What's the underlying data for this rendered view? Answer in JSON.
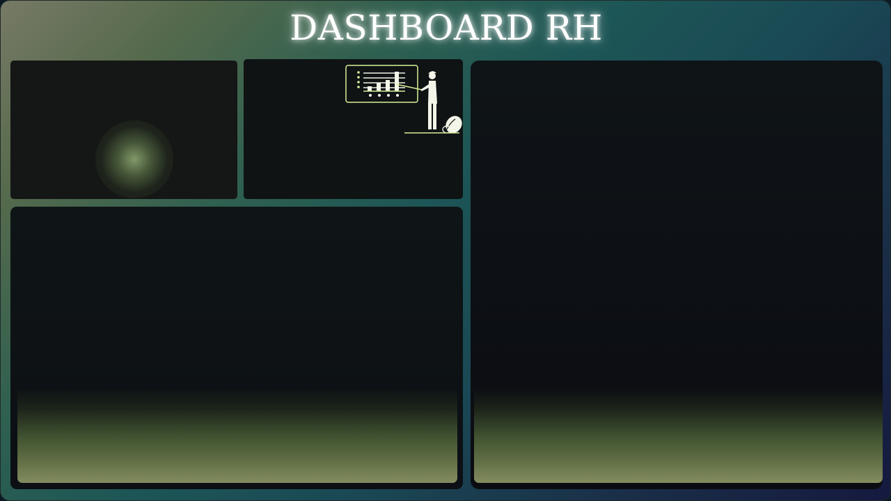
{
  "header": {
    "title": "DASHBOARD RH"
  },
  "theme": {
    "accent": "#d8f29a",
    "panel_bg": "#0f1314",
    "background_gradient": [
      "#777a66",
      "#1d5656",
      "#15193f"
    ]
  },
  "panels": {
    "kpi_left": {
      "icon": "glow-orb"
    },
    "kpi_right": {
      "icon": "presenter-chart-illustration"
    },
    "bottom_left": {},
    "right_large": {}
  }
}
